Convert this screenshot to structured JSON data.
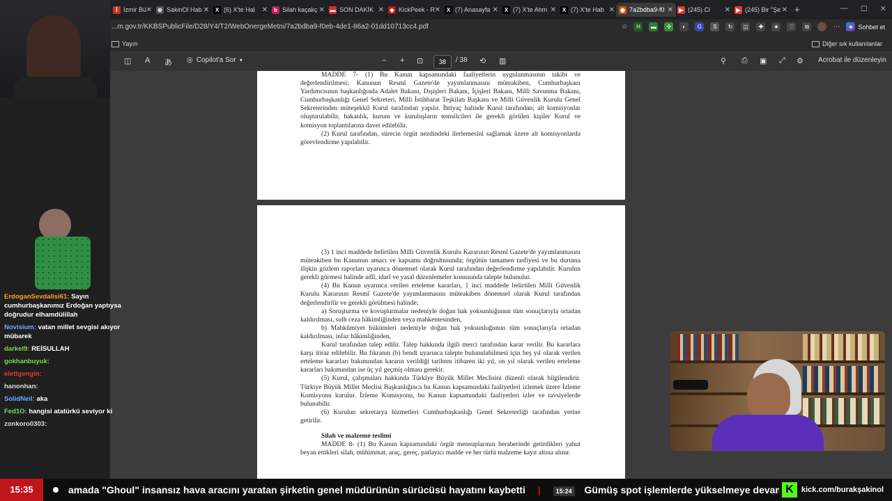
{
  "browser": {
    "tabs": [
      {
        "label": "İzmir Büyükş",
        "color": "#c0392b",
        "glyph": "İ"
      },
      {
        "label": "SakinOl Hab",
        "color": "#555",
        "glyph": "⊕"
      },
      {
        "label": "(6) X'te Hal",
        "color": "#000",
        "glyph": "X"
      },
      {
        "label": "Silah kaçakç",
        "color": "#c2185b",
        "glyph": "b"
      },
      {
        "label": "SON DAKİK",
        "color": "#d32f2f",
        "glyph": "▬"
      },
      {
        "label": "KickPeek - R",
        "color": "#b71c1c",
        "glyph": "◆"
      },
      {
        "label": "(7) Anasayfa",
        "color": "#000",
        "glyph": "X"
      },
      {
        "label": "(7) X'te Ahm",
        "color": "#000",
        "glyph": "X"
      },
      {
        "label": "(7) X'te Hab",
        "color": "#000",
        "glyph": "X"
      },
      {
        "label": "7a2bdba9-f0",
        "color": "#d35400",
        "glyph": "◉"
      },
      {
        "label": "(245) Cl",
        "color": "#e53935",
        "glyph": "▶"
      },
      {
        "label": "(245) Bir \"Şe",
        "color": "#e53935",
        "glyph": "▶"
      }
    ],
    "url": "...m.gov.tr/KKBSPublicFile/D28/Y4/T2/WebOnergeMetni/7a2bdba9-f0eb-4de1-86a2-01dd10713cc4.pdf",
    "sohbet_label": "Sohbet et",
    "fav_item": "Yayın",
    "fav_other": "Diğer sık kullanılanlar"
  },
  "pdf_toolbar": {
    "copilot_label": "Copilot'a Sor",
    "page_current": "38",
    "page_total": "/ 38",
    "acrobat_label": "Acrobat ile düzenleyin",
    "zoom_minus": "−",
    "zoom_plus": "+"
  },
  "page1": [
    {
      "text": "MADDE 7- (1) Bu Kanun kapsamındaki faaliyetlerin uygulanmasının takibi ve değerlendirilmesi; Kanunun Resmî Gazete'de yayımlanmasını müteakiben, Cumhurbaşkanı Yardımcısının başkanlığında Adalet Bakanı, Dışişleri Bakanı, İçişleri Bakanı, Milli Savunma Bakanı, Cumhurbaşkanlığı Genel Sekreteri, Milli İstihbarat Teşkilatı Başkanı ve Milli Güvenlik Kurulu Genel Sekreterinden müteşekkil Kurul tarafından yapılır. İhtiyaç halinde Kurul tarafından; alt komisyonlar oluşturulabilir, bakanlık, kurum ve kuruluşların temsilcileri ile gerekli görülen kişiler Kurul ve komisyon toplantılarına davet edilebilir."
    },
    {
      "text": "(2) Kurul tarafından, sürecin örgüt nezdindeki ilerlemesini sağlamak üzere alt komisyonlarda görevlendirme yapılabilir."
    }
  ],
  "page2": [
    {
      "text": "(3) 1 inci maddede belirtilen Milli Güvenlik Kurulu Kararının Resmî Gazete'de yayımlanmasını müteakiben bu Kanunun amacı ve kapsamı doğrultusunda; örgütün tamamen tasfiyesi ve bu duruma ilişkin gözlem raporları uyarınca dönemsel olarak Kurul tarafından değerlendirme yapılabilir. Kurulun gerekli görmesi halinde adlî, idarî ve yasal düzenlemeler konusunda talepte bulunulur."
    },
    {
      "text": "(4) Bu Kanun uyarınca verilen erteleme kararları, 1 inci maddede belirtilen Milli Güvenlik Kurulu Kararının Resmî Gazete'de yayımlanmasını müteakiben dönemsel olarak Kurul tarafından değerlendirilir ve gerekli görülmesi halinde;"
    },
    {
      "text": "a) Soruşturma ve kovuşturmalar nedeniyle doğan hak yoksunluğunun tüm sonuçlarıyla ortadan kaldırılması, sulh ceza hâkimliğinden veya mahkemesinden,"
    },
    {
      "text": "b) Mahkûmiyet hükümleri nedeniyle doğan hak yoksunluğunun tüm sonuçlarıyla ortadan kaldırılması, infaz hâkimliğinden,"
    },
    {
      "text": "Kurul tarafından talep edilir. Talep hakkında ilgili merci tarafından karar verilir. Bu kararlara karşı itiraz edilebilir. Bu fıkranın (b) bendi uyarınca talepte bulunulabilmesi için beş yıl olarak verilen erteleme kararları bakımından kararın verildiği tarihten itibaren iki yıl, on yıl olarak verilen erteleme kararları bakımından ise üç yıl geçmiş olması gerekir."
    },
    {
      "text": "(5) Kurul, çalışmaları hakkında Türkiye Büyük Millet Meclisini düzenli olarak bilgilendirir. Türkiye Büyük Millet Meclisi Başkanlığınca bu Kanun kapsamındaki faaliyetleri izlemek üzere İzleme Komisyonu kurulur. İzleme Komisyonu, bu Kanun kapsamındaki faaliyetleri izler ve tavsiyelerde bulunabilir."
    },
    {
      "text": "(6) Kurulun sekretarya hizmetleri Cumhurbaşkanlığı Genel Sekreterliği tarafından yerine getirilir."
    }
  ],
  "page2_heading": "Silah ve malzeme teslimi",
  "page2_last": "MADDE 8- (1) Bu Kanun kapsamındaki örgüt mensuplarının beraberinde getirdikleri yahut beyan ettikleri silah, mühimmat, araç, gereç, patlayıcı madde ve her türlü malzeme kayıt altına alınır.",
  "chat": [
    {
      "user": "ErdoganSevdalisi61:",
      "color": "#f5a623",
      "text": "Sayın cumhurbaşkanımız Erdoğan yaptıysa doğrudur elhamdülillah"
    },
    {
      "user": "Novisium:",
      "color": "#6fa8ff",
      "text": "vatan millet sevgisi akıyor mübarek"
    },
    {
      "user": "darkel9:",
      "color": "#7ed957",
      "text": "REİSULLAH"
    },
    {
      "user": "gokhanbuyuk:",
      "color": "#7ed957",
      "text": ""
    },
    {
      "user": "elettgengin:",
      "color": "#e53935",
      "text": ""
    },
    {
      "user": "hanonhan:",
      "color": "#ddd",
      "text": ""
    },
    {
      "user": "SolidNeil:",
      "color": "#6fa8ff",
      "text": "aka"
    },
    {
      "user": "Fed1O:",
      "color": "#7ed957",
      "text": "hangisi atatürkü seviyor ki"
    },
    {
      "user": "zonkoro0303:",
      "color": "#ddd",
      "text": ""
    }
  ],
  "ticker": {
    "clock": "15:35",
    "news1": "amada \"Ghoul\" insansız hava aracını yaratan şirketin genel müdürünün sürücüsü hayatını kaybetti",
    "separator": "|",
    "time2": "15:24",
    "news2": "Gümüş spot işlemlerde yükselmeye devam ediyor",
    "kick_handle": "kick.com/burakşakinol"
  }
}
